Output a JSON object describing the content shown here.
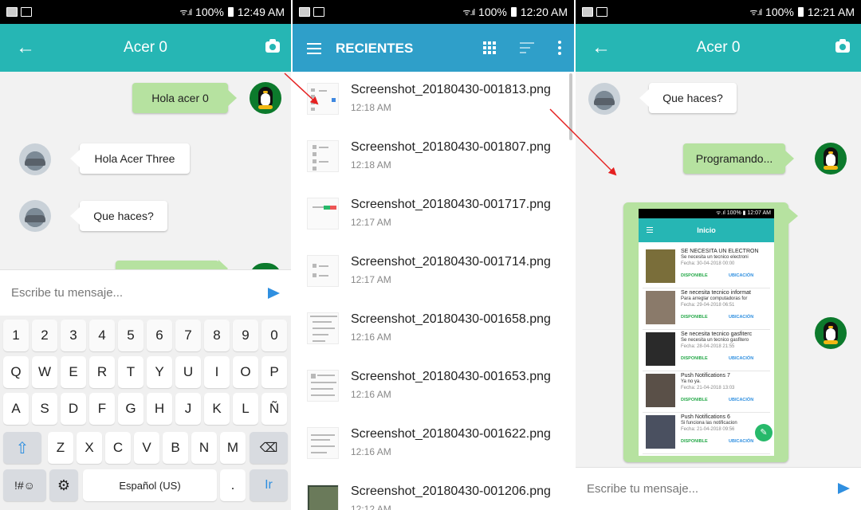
{
  "panel1": {
    "status": {
      "signal": "ᯤ.ıl",
      "battery_pct": "100%",
      "time": "12:49 AM"
    },
    "appbar": {
      "back_icon": "arrow-back-icon",
      "title": "Acer 0",
      "camera_icon": "camera-icon"
    },
    "messages": [
      {
        "text": "Hola acer 0",
        "side": "right"
      },
      {
        "text": "Hola Acer Three",
        "side": "left"
      },
      {
        "text": "Que haces?",
        "side": "left"
      }
    ],
    "composer": {
      "placeholder": "Escribe tu mensaje..."
    },
    "keyboard": {
      "row1": [
        "1",
        "2",
        "3",
        "4",
        "5",
        "6",
        "7",
        "8",
        "9",
        "0"
      ],
      "row2": [
        "Q",
        "W",
        "E",
        "R",
        "T",
        "Y",
        "U",
        "I",
        "O",
        "P"
      ],
      "row3": [
        "A",
        "S",
        "D",
        "F",
        "G",
        "H",
        "J",
        "K",
        "L",
        "Ñ"
      ],
      "row4": [
        "Z",
        "X",
        "C",
        "V",
        "B",
        "N",
        "M"
      ],
      "row5": {
        "symbols": "!#☺",
        "space": "Español (US)",
        "period": ".",
        "go": "Ir"
      },
      "shift_icon": "shift-icon",
      "backspace_icon": "backspace-icon",
      "settings_icon": "settings-icon"
    }
  },
  "panel2": {
    "status": {
      "signal": "ᯤ.ıl",
      "battery_pct": "100%",
      "time": "12:20 AM"
    },
    "appbar": {
      "title": "RECIENTES",
      "menu_icon": "hamburger-icon",
      "grid_icon": "grid-view-icon",
      "sort_icon": "sort-icon",
      "more_icon": "more-vert-icon"
    },
    "files": [
      {
        "name": "Screenshot_20180430-001813.png",
        "time": "12:18 AM"
      },
      {
        "name": "Screenshot_20180430-001807.png",
        "time": "12:18 AM"
      },
      {
        "name": "Screenshot_20180430-001717.png",
        "time": "12:17 AM"
      },
      {
        "name": "Screenshot_20180430-001714.png",
        "time": "12:17 AM"
      },
      {
        "name": "Screenshot_20180430-001658.png",
        "time": "12:16 AM"
      },
      {
        "name": "Screenshot_20180430-001653.png",
        "time": "12:16 AM"
      },
      {
        "name": "Screenshot_20180430-001622.png",
        "time": "12:16 AM"
      },
      {
        "name": "Screenshot_20180430-001206.png",
        "time": "12:12 AM"
      }
    ]
  },
  "panel3": {
    "status": {
      "signal": "ᯤ.ıl",
      "battery_pct": "100%",
      "time": "12:21 AM"
    },
    "appbar": {
      "back_icon": "arrow-back-icon",
      "title": "Acer 0",
      "camera_icon": "camera-icon"
    },
    "messages": [
      {
        "text": "Que haces?",
        "side": "left"
      },
      {
        "text": "Programando...",
        "side": "right"
      }
    ],
    "image_message": {
      "status_time": "ᯤ.ıl 100% ▮ 12:07 AM",
      "title": "Inicio",
      "cards": [
        {
          "title": "SE NECESITA UN ELECTRON",
          "subtitle": "Se necesita un tecnico electroni",
          "date": "Fecha: 30-04-2018 00:00",
          "tag1": "DISPONIBLE",
          "tag2": "UBICACIÓN",
          "img_color": "#7a6e3a"
        },
        {
          "title": "Se necesita tecnico informat",
          "subtitle": "Para arreglar computadoras for",
          "date": "Fecha: 29-04-2018 06:51",
          "tag1": "DISPONIBLE",
          "tag2": "UBICACIÓN",
          "img_color": "#8a7a6a"
        },
        {
          "title": "Se necesita tecnico gasfiterc",
          "subtitle": "Se necesita un tecnico gasfitero",
          "date": "Fecha: 28-04-2018 21:55",
          "tag1": "DISPONIBLE",
          "tag2": "UBICACIÓN",
          "img_color": "#2a2a2a"
        },
        {
          "title": "Push Notifications 7",
          "subtitle": "Ya no ya.",
          "date": "Fecha: 21-04-2018 13:03",
          "tag1": "DISPONIBLE",
          "tag2": "UBICACIÓN",
          "img_color": "#5a5048"
        },
        {
          "title": "Push Notifications 6",
          "subtitle": "Si funciona las notificacion",
          "date": "Fecha: 21-04-2018 09:56",
          "tag1": "DISPONIBLE",
          "tag2": "UBICACIÓN",
          "img_color": "#4a5060"
        }
      ],
      "fab_icon": "edit-icon"
    },
    "composer": {
      "placeholder": "Escribe tu mensaje..."
    }
  },
  "colors": {
    "teal": "#26b6b4",
    "blue": "#2f9fc9",
    "green_bubble": "#b6e2a0",
    "send": "#2f8fe0",
    "arrow": "#e52121"
  }
}
